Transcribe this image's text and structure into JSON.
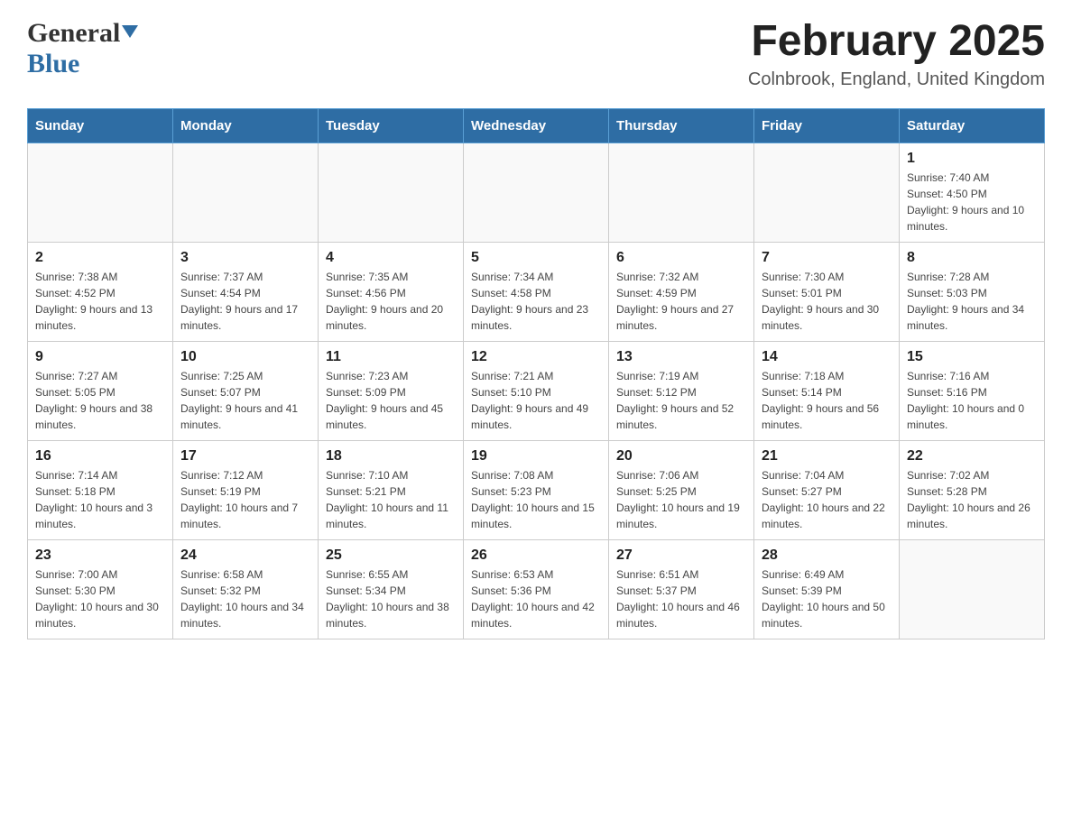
{
  "header": {
    "logo_general": "General",
    "logo_blue": "Blue",
    "title": "February 2025",
    "location": "Colnbrook, England, United Kingdom"
  },
  "days_of_week": [
    "Sunday",
    "Monday",
    "Tuesday",
    "Wednesday",
    "Thursday",
    "Friday",
    "Saturday"
  ],
  "weeks": [
    [
      {
        "day": "",
        "info": ""
      },
      {
        "day": "",
        "info": ""
      },
      {
        "day": "",
        "info": ""
      },
      {
        "day": "",
        "info": ""
      },
      {
        "day": "",
        "info": ""
      },
      {
        "day": "",
        "info": ""
      },
      {
        "day": "1",
        "info": "Sunrise: 7:40 AM\nSunset: 4:50 PM\nDaylight: 9 hours and 10 minutes."
      }
    ],
    [
      {
        "day": "2",
        "info": "Sunrise: 7:38 AM\nSunset: 4:52 PM\nDaylight: 9 hours and 13 minutes."
      },
      {
        "day": "3",
        "info": "Sunrise: 7:37 AM\nSunset: 4:54 PM\nDaylight: 9 hours and 17 minutes."
      },
      {
        "day": "4",
        "info": "Sunrise: 7:35 AM\nSunset: 4:56 PM\nDaylight: 9 hours and 20 minutes."
      },
      {
        "day": "5",
        "info": "Sunrise: 7:34 AM\nSunset: 4:58 PM\nDaylight: 9 hours and 23 minutes."
      },
      {
        "day": "6",
        "info": "Sunrise: 7:32 AM\nSunset: 4:59 PM\nDaylight: 9 hours and 27 minutes."
      },
      {
        "day": "7",
        "info": "Sunrise: 7:30 AM\nSunset: 5:01 PM\nDaylight: 9 hours and 30 minutes."
      },
      {
        "day": "8",
        "info": "Sunrise: 7:28 AM\nSunset: 5:03 PM\nDaylight: 9 hours and 34 minutes."
      }
    ],
    [
      {
        "day": "9",
        "info": "Sunrise: 7:27 AM\nSunset: 5:05 PM\nDaylight: 9 hours and 38 minutes."
      },
      {
        "day": "10",
        "info": "Sunrise: 7:25 AM\nSunset: 5:07 PM\nDaylight: 9 hours and 41 minutes."
      },
      {
        "day": "11",
        "info": "Sunrise: 7:23 AM\nSunset: 5:09 PM\nDaylight: 9 hours and 45 minutes."
      },
      {
        "day": "12",
        "info": "Sunrise: 7:21 AM\nSunset: 5:10 PM\nDaylight: 9 hours and 49 minutes."
      },
      {
        "day": "13",
        "info": "Sunrise: 7:19 AM\nSunset: 5:12 PM\nDaylight: 9 hours and 52 minutes."
      },
      {
        "day": "14",
        "info": "Sunrise: 7:18 AM\nSunset: 5:14 PM\nDaylight: 9 hours and 56 minutes."
      },
      {
        "day": "15",
        "info": "Sunrise: 7:16 AM\nSunset: 5:16 PM\nDaylight: 10 hours and 0 minutes."
      }
    ],
    [
      {
        "day": "16",
        "info": "Sunrise: 7:14 AM\nSunset: 5:18 PM\nDaylight: 10 hours and 3 minutes."
      },
      {
        "day": "17",
        "info": "Sunrise: 7:12 AM\nSunset: 5:19 PM\nDaylight: 10 hours and 7 minutes."
      },
      {
        "day": "18",
        "info": "Sunrise: 7:10 AM\nSunset: 5:21 PM\nDaylight: 10 hours and 11 minutes."
      },
      {
        "day": "19",
        "info": "Sunrise: 7:08 AM\nSunset: 5:23 PM\nDaylight: 10 hours and 15 minutes."
      },
      {
        "day": "20",
        "info": "Sunrise: 7:06 AM\nSunset: 5:25 PM\nDaylight: 10 hours and 19 minutes."
      },
      {
        "day": "21",
        "info": "Sunrise: 7:04 AM\nSunset: 5:27 PM\nDaylight: 10 hours and 22 minutes."
      },
      {
        "day": "22",
        "info": "Sunrise: 7:02 AM\nSunset: 5:28 PM\nDaylight: 10 hours and 26 minutes."
      }
    ],
    [
      {
        "day": "23",
        "info": "Sunrise: 7:00 AM\nSunset: 5:30 PM\nDaylight: 10 hours and 30 minutes."
      },
      {
        "day": "24",
        "info": "Sunrise: 6:58 AM\nSunset: 5:32 PM\nDaylight: 10 hours and 34 minutes."
      },
      {
        "day": "25",
        "info": "Sunrise: 6:55 AM\nSunset: 5:34 PM\nDaylight: 10 hours and 38 minutes."
      },
      {
        "day": "26",
        "info": "Sunrise: 6:53 AM\nSunset: 5:36 PM\nDaylight: 10 hours and 42 minutes."
      },
      {
        "day": "27",
        "info": "Sunrise: 6:51 AM\nSunset: 5:37 PM\nDaylight: 10 hours and 46 minutes."
      },
      {
        "day": "28",
        "info": "Sunrise: 6:49 AM\nSunset: 5:39 PM\nDaylight: 10 hours and 50 minutes."
      },
      {
        "day": "",
        "info": ""
      }
    ]
  ]
}
